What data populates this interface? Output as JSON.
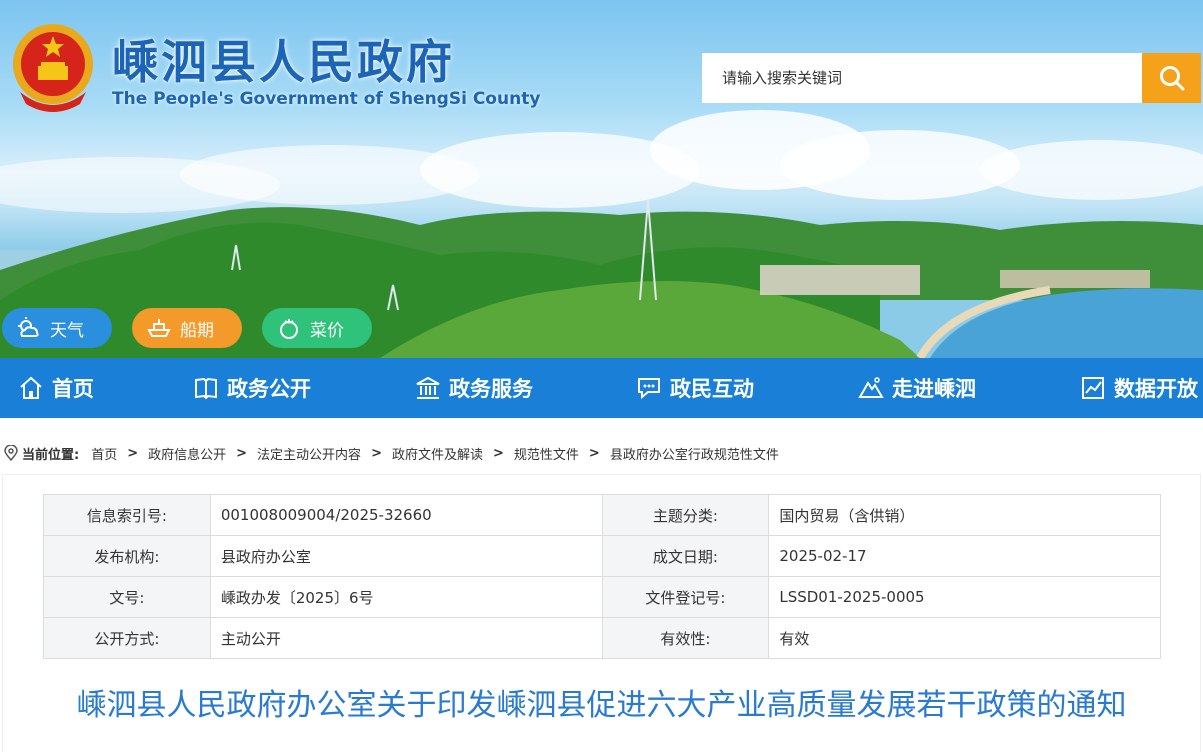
{
  "header": {
    "title": "嵊泗县人民政府",
    "subtitle": "The People's Government of ShengSi County"
  },
  "search": {
    "placeholder": "请输入搜索关键词"
  },
  "quick_links": [
    {
      "label": "天气",
      "icon": "weather-icon"
    },
    {
      "label": "船期",
      "icon": "ship-icon"
    },
    {
      "label": "菜价",
      "icon": "vegetable-icon"
    }
  ],
  "nav": {
    "items": [
      {
        "label": "首页",
        "icon": "home-icon"
      },
      {
        "label": "政务公开",
        "icon": "book-icon"
      },
      {
        "label": "政务服务",
        "icon": "building-icon"
      },
      {
        "label": "政民互动",
        "icon": "chat-icon"
      },
      {
        "label": "走进嵊泗",
        "icon": "mountain-icon"
      },
      {
        "label": "数据开放",
        "icon": "chart-icon"
      }
    ]
  },
  "breadcrumb": {
    "label": "当前位置:",
    "items": [
      "首页",
      "政府信息公开",
      "法定主动公开内容",
      "政府文件及解读",
      "规范性文件",
      "县政府办公室行政规范性文件"
    ],
    "separator": ">"
  },
  "info_table": {
    "rows": [
      {
        "k1": "信息索引号:",
        "v1": "001008009004/2025-32660",
        "k2": "主题分类:",
        "v2": "国内贸易（含供销）"
      },
      {
        "k1": "发布机构:",
        "v1": "县政府办公室",
        "k2": "成文日期:",
        "v2": "2025-02-17"
      },
      {
        "k1": "文号:",
        "v1": "嵊政办发〔2025〕6号",
        "k2": "文件登记号:",
        "v2": "LSSD01-2025-0005"
      },
      {
        "k1": "公开方式:",
        "v1": "主动公开",
        "k2": "有效性:",
        "v2": "有效"
      }
    ]
  },
  "document": {
    "title": "嵊泗县人民政府办公室关于印发嵊泗县促进六大产业高质量发展若干政策的通知"
  },
  "colors": {
    "brand_blue": "#1a7fd6",
    "title_blue": "#1c64b5",
    "search_orange": "#f5a21a",
    "pill_blue": "#2a8fdc",
    "pill_orange": "#f39a2a",
    "pill_green": "#2ec27a",
    "doc_title": "#2a7bd0"
  }
}
